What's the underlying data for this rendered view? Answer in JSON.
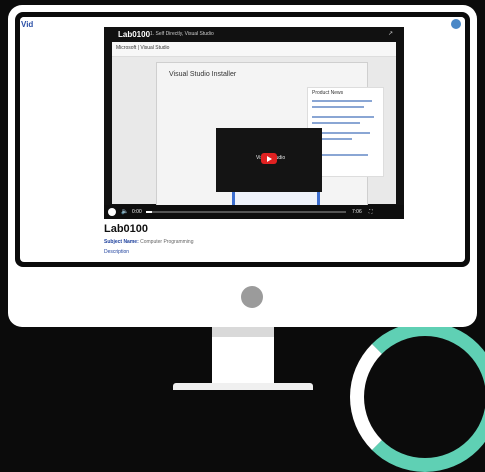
{
  "site": {
    "logo": "Vid"
  },
  "video": {
    "channel_title": "Lab0100",
    "subtitle": "1. Self Directly, Visual Studio",
    "share": "↗",
    "web_nav_brand": "Microsoft | Visual Studio",
    "installer_title": "Visual Studio Installer",
    "notes_title": "Product News",
    "player_label": "Visual Studio",
    "controls": {
      "volume_icon": "🔈",
      "time": "0:00",
      "length": "7:06",
      "fullscreen": "⛶",
      "progress": 0.03
    }
  },
  "page": {
    "title": "Lab0100",
    "subject_label": "Subject Name:",
    "subject_value": "Computer Programming",
    "description": "Description"
  }
}
